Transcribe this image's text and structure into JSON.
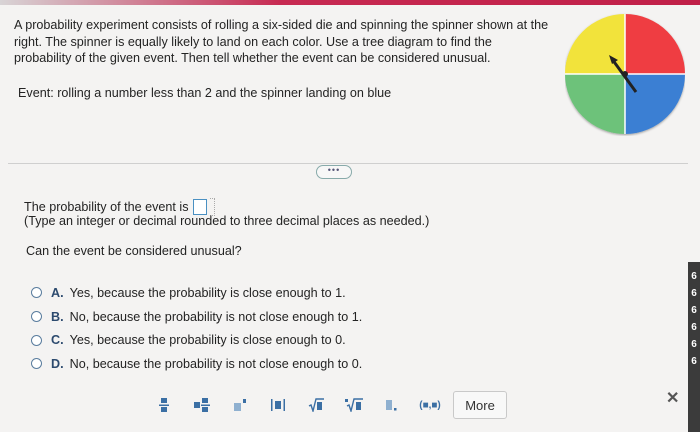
{
  "question": {
    "line1": "A probability experiment consists of rolling a six-sided die and spinning the spinner shown at the",
    "line2": "right. The spinner is equally likely to land on each color. Use a tree diagram to find the",
    "line3": "probability of the given event. Then tell whether the event can be considered unusual.",
    "event": "Event: rolling a number less than 2 and the spinner landing on blue"
  },
  "spinner": {
    "colors": {
      "yellow": "#f2e33b",
      "red": "#ef3e42",
      "green": "#6dc27a",
      "blue": "#3a7fd3"
    }
  },
  "divider": {
    "more_label": "•••"
  },
  "answer": {
    "prob_label": "The probability of the event is",
    "hint": "(Type an integer or decimal rounded to three decimal places as needed.)",
    "unusual_question": "Can the event be considered unusual?"
  },
  "options": [
    {
      "letter": "A.",
      "text": "Yes, because the probability is close enough to 1."
    },
    {
      "letter": "B.",
      "text": "No, because the probability is not close enough to 1."
    },
    {
      "letter": "C.",
      "text": "Yes, because the probability is close enough to 0."
    },
    {
      "letter": "D.",
      "text": "No, because the probability is not close enough to 0."
    }
  ],
  "toolbar": {
    "tools": [
      "fraction-icon",
      "mixed-number-icon",
      "exponent-icon",
      "absolute-value-icon",
      "sqrt-icon",
      "nth-root-icon",
      "decimal-icon",
      "interval-icon"
    ],
    "interval_label": "(■,■)",
    "more_label": "More",
    "close_label": "✕"
  },
  "right_edge": [
    "6",
    "6",
    "6",
    "6",
    "6",
    "6"
  ]
}
